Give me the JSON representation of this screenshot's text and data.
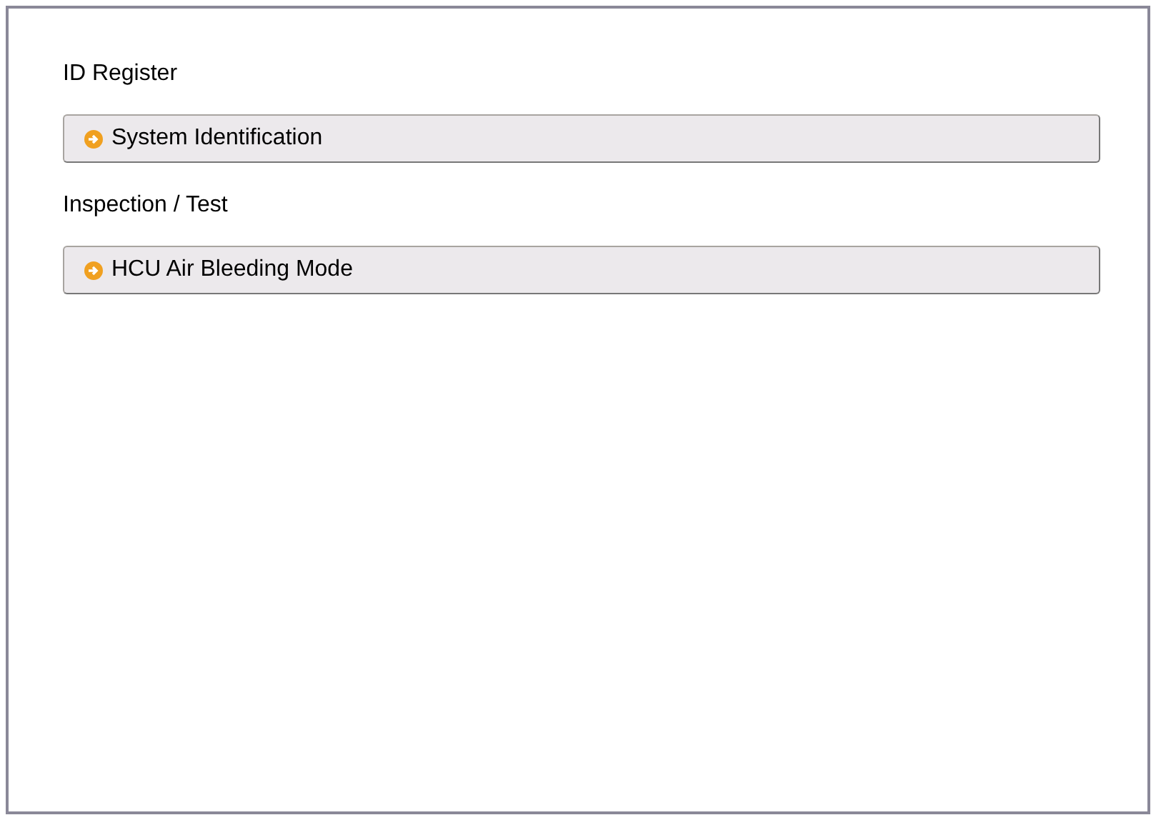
{
  "sections": [
    {
      "heading": "ID Register",
      "items": [
        {
          "label": "System Identification"
        }
      ]
    },
    {
      "heading": "Inspection / Test",
      "items": [
        {
          "label": "HCU Air Bleeding Mode"
        }
      ]
    }
  ]
}
